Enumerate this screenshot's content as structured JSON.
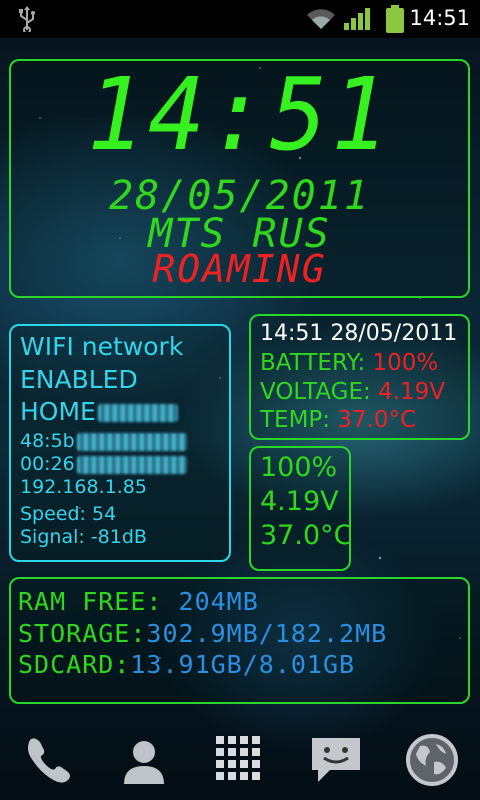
{
  "status_bar": {
    "time": "14:51",
    "icons": [
      "usb-icon",
      "wifi-icon",
      "cell-signal-icon",
      "battery-icon"
    ]
  },
  "clock_widget": {
    "time": "14:51",
    "date": "28/05/2011",
    "operator": "MTS RUS",
    "roaming": "ROAMING"
  },
  "wifi_widget": {
    "title": "WIFI network",
    "state": "ENABLED",
    "ssid": "HOME",
    "mac_prefix": "48:5b",
    "bssid_prefix": "00:26",
    "ip": "192.168.1.85",
    "speed": "Speed: 54",
    "signal": "Signal: -81dB"
  },
  "battery_widget": {
    "header": "14:51 28/05/2011",
    "battery_label": "BATTERY:",
    "battery_value": "100%",
    "voltage_label": "VOLTAGE:",
    "voltage_value": "4.19V",
    "temp_label": "TEMP:",
    "temp_value": "37.0°C"
  },
  "battery_mini": {
    "percent": "100%",
    "voltage": "4.19V",
    "temp": "37.0°C"
  },
  "memory_widget": {
    "ram_label": "RAM FREE:",
    "ram_value": "204MB",
    "storage_label": "STORAGE:",
    "storage_value": "302.9MB/182.2MB",
    "sdcard_label": "SDCARD:",
    "sdcard_value": "13.91GB/8.01GB"
  },
  "dock": [
    "phone-icon",
    "contacts-icon",
    "app-drawer-icon",
    "messaging-icon",
    "browser-icon"
  ],
  "colors": {
    "green": "#2fd81c",
    "cyan": "#34d4ec",
    "red": "#e22222",
    "blue": "#2a8fe0"
  }
}
